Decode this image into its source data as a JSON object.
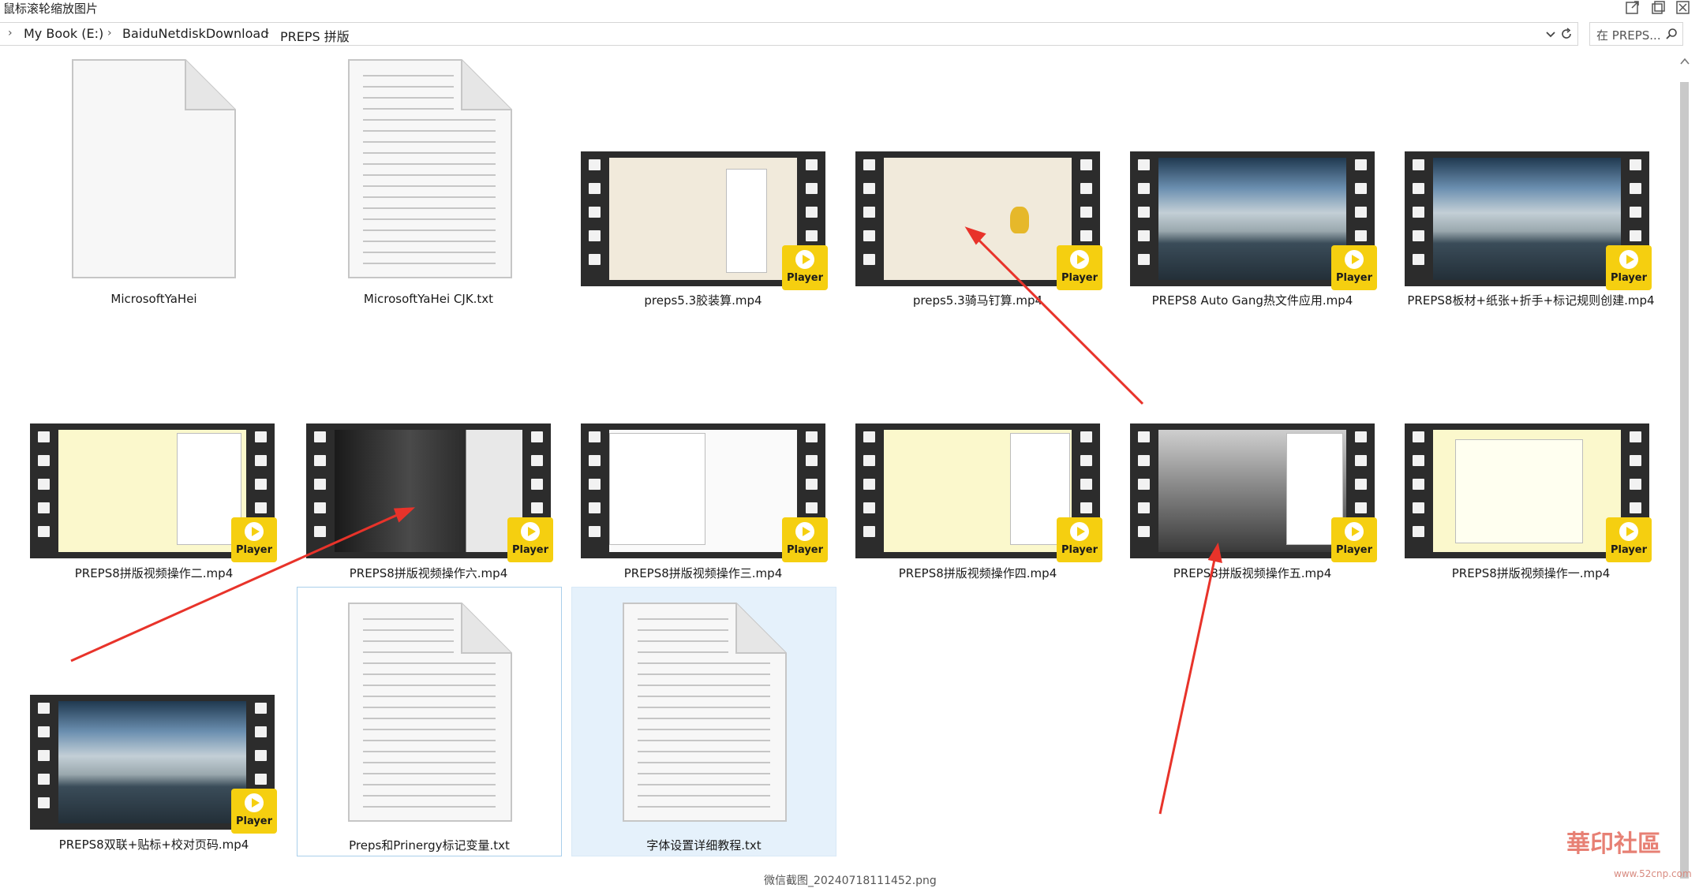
{
  "window": {
    "title": "鼠标滚轮缩放图片"
  },
  "breadcrumb": {
    "items": [
      "My Book (E:)",
      "BaiduNetdiskDownload",
      "PREPS 拼版"
    ]
  },
  "search": {
    "placeholder": "在 PREPS..."
  },
  "files": [
    {
      "name": "MicrosoftYaHei",
      "kind": "blank-document"
    },
    {
      "name": "MicrosoftYaHei CJK.txt",
      "kind": "text-document"
    },
    {
      "name": "preps5.3胶装算.mp4",
      "kind": "video"
    },
    {
      "name": "preps5.3骑马钉算.mp4",
      "kind": "video"
    },
    {
      "name": "PREPS8 Auto Gang热文件应用.mp4",
      "kind": "video"
    },
    {
      "name": "PREPS8板材+纸张+折手+标记规则创建.mp4",
      "kind": "video"
    },
    {
      "name": "PREPS8拼版视频操作二.mp4",
      "kind": "video"
    },
    {
      "name": "PREPS8拼版视频操作六.mp4",
      "kind": "video"
    },
    {
      "name": "PREPS8拼版视频操作三.mp4",
      "kind": "video"
    },
    {
      "name": "PREPS8拼版视频操作四.mp4",
      "kind": "video"
    },
    {
      "name": "PREPS8拼版视频操作五.mp4",
      "kind": "video"
    },
    {
      "name": "PREPS8拼版视频操作一.mp4",
      "kind": "video"
    },
    {
      "name": "PREPS8双联+贴标+校对页码.mp4",
      "kind": "video"
    },
    {
      "name": "Preps和Prinergy标记变量.txt",
      "kind": "text-document"
    },
    {
      "name": "字体设置详细教程.txt",
      "kind": "text-document"
    }
  ],
  "player_badge": {
    "label": "Player"
  },
  "status": {
    "filename": "微信截图_20240718111452.png"
  },
  "watermark": {
    "text": "華印社區",
    "url": "www.52cnp.com"
  },
  "colors": {
    "selection": "#e5f1fb",
    "badge": "#f5cf10",
    "annotation_arrow": "#e8332a"
  }
}
